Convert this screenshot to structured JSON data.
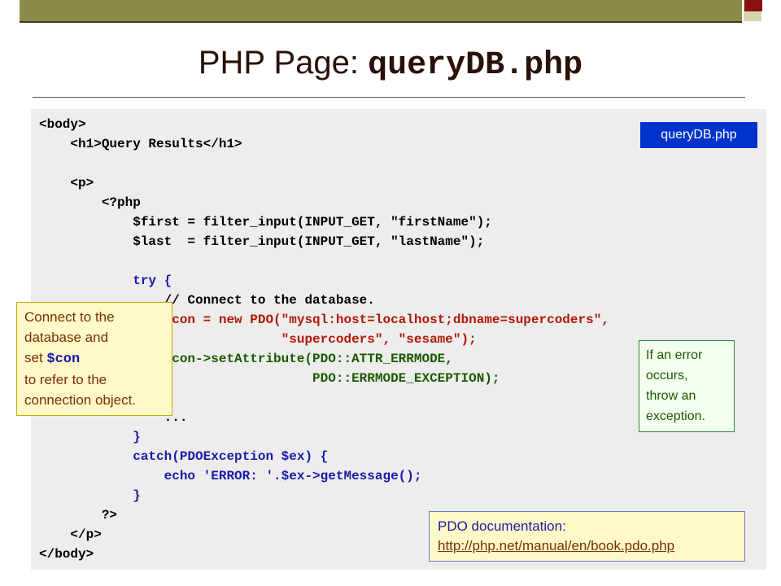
{
  "slide": {
    "title_prefix": "PHP Page: ",
    "title_file": "queryDB.php"
  },
  "code_lines": [
    "<body>",
    "    <h1>Query Results</h1>",
    "",
    "    <p>",
    "        <?php",
    "            $first = filter_input(INPUT_GET, \"firstName\");",
    "            $last  = filter_input(INPUT_GET, \"lastName\");",
    "",
    "            try {",
    "                // Connect to the database.",
    "                $con = new PDO(\"mysql:host=localhost;dbname=supercoders\",",
    "                               \"supercoders\", \"sesame\");",
    "                $con->setAttribute(PDO::ATTR_ERRMODE,",
    "                                   PDO::ERRMODE_EXCEPTION);",
    "",
    "                ...",
    "            }",
    "            catch(PDOException $ex) {",
    "                echo 'ERROR: '.$ex->getMessage();",
    "            }",
    "        ?>",
    "    </p>",
    "</body>"
  ],
  "callouts": {
    "file_label": "queryDB.php",
    "connect_note": {
      "line1": "Connect to the",
      "line2": "database and",
      "line3_prefix": "set ",
      "line3_var": "$con",
      "line4": "to refer to the",
      "line5": "connection object."
    },
    "error_note": {
      "line1": "If an error",
      "line2": "occurs,",
      "line3": "throw an",
      "line4": "exception."
    },
    "doc_note": {
      "heading": "PDO documentation:",
      "link": "http://php.net/manual/en/book.pdo.php"
    }
  },
  "colors": {
    "top_bar": "#8c8a4a",
    "code_keyword": "#1a1aa8",
    "code_connect": "#b01800",
    "code_catch": "#1a5a00",
    "file_label_bg": "#0033cc"
  }
}
